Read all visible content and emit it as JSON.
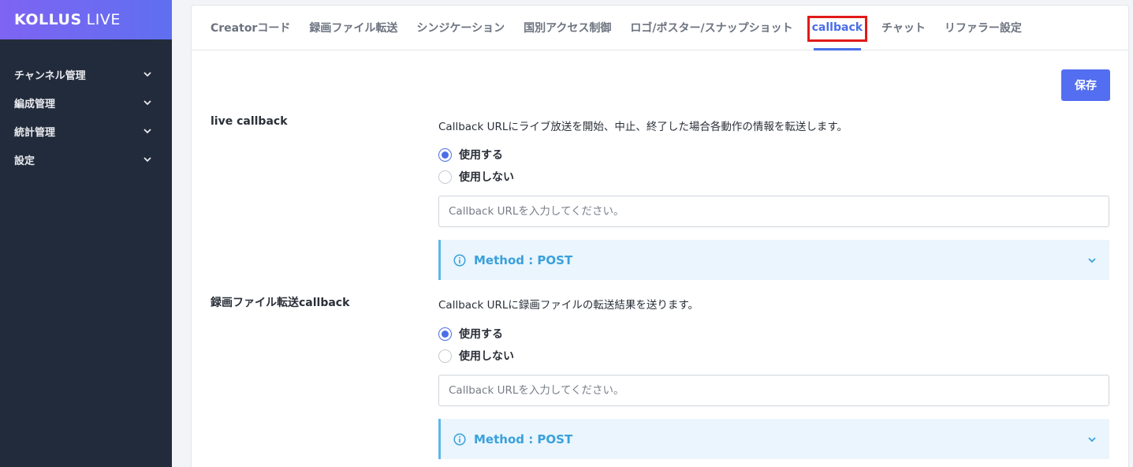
{
  "logo": {
    "bold": "KOLLUS",
    "light": "LIVE"
  },
  "sidebar": {
    "items": [
      {
        "label": "チャンネル管理"
      },
      {
        "label": "編成管理"
      },
      {
        "label": "統計管理"
      },
      {
        "label": "設定"
      }
    ]
  },
  "tabs": [
    {
      "label": "Creatorコード"
    },
    {
      "label": "録画ファイル転送"
    },
    {
      "label": "シンジケーション"
    },
    {
      "label": "国別アクセス制御"
    },
    {
      "label": "ロゴ/ポスター/スナップショット"
    },
    {
      "label": "callback",
      "active": true
    },
    {
      "label": "チャット"
    },
    {
      "label": "リファラー設定"
    }
  ],
  "save_label": "保存",
  "sections": [
    {
      "label": "live callback",
      "description": "Callback URLにライブ放送を開始、中止、終了した場合各動作の情報を転送します。",
      "radio_use": "使用する",
      "radio_not_use": "使用しない",
      "selected": "use",
      "input_placeholder": "Callback URLを入力してください。",
      "input_value": "",
      "info_title": "Method : POST"
    },
    {
      "label": "録画ファイル転送callback",
      "description": "Callback URLに録画ファイルの転送結果を送ります。",
      "radio_use": "使用する",
      "radio_not_use": "使用しない",
      "selected": "use",
      "input_placeholder": "Callback URLを入力してください。",
      "input_value": "",
      "info_title": "Method : POST"
    }
  ],
  "colors": {
    "accent": "#4a6ee8",
    "sidebar_bg": "#222b3b",
    "info_bg": "#eaf5fd",
    "info_text": "#3aa0dc",
    "highlight": "#e01a1a"
  }
}
